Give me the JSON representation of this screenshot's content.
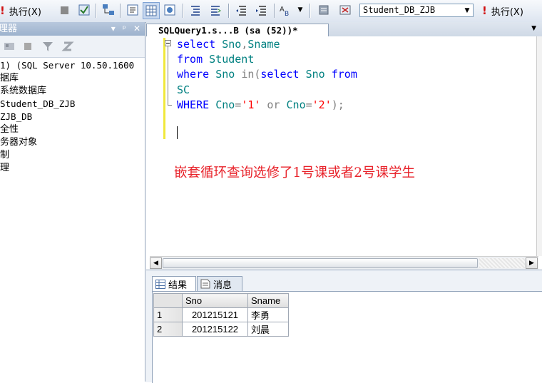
{
  "toolbar": {
    "execute_label": "执行(X)",
    "database": "Student_DB_ZJB",
    "execute_label_2": "执行(X)"
  },
  "explorer": {
    "title": "理器",
    "pin_symbol": "▾ ᵖ ✕",
    "items": [
      "1) (SQL Server 10.50.1600",
      "据库",
      "系统数据库",
      "Student_DB_ZJB",
      "ZJB_DB",
      "全性",
      "务器对象",
      "制",
      "理"
    ]
  },
  "editor": {
    "tab_label": "SQLQuery1.s...B (sa (52))*",
    "lines": [
      [
        {
          "t": "select ",
          "c": "kw"
        },
        {
          "t": "Sno",
          "c": "id"
        },
        {
          "t": ",",
          "c": "op"
        },
        {
          "t": "Sname",
          "c": "id"
        }
      ],
      [
        {
          "t": "from ",
          "c": "kw"
        },
        {
          "t": "Student",
          "c": "id"
        }
      ],
      [
        {
          "t": "where ",
          "c": "kw"
        },
        {
          "t": "Sno ",
          "c": "id"
        },
        {
          "t": "in",
          "c": "op"
        },
        {
          "t": "(",
          "c": "op"
        },
        {
          "t": "select ",
          "c": "kw"
        },
        {
          "t": "Sno ",
          "c": "id"
        },
        {
          "t": "from",
          "c": "kw"
        }
      ],
      [
        {
          "t": "SC",
          "c": "id"
        }
      ],
      [
        {
          "t": "WHERE ",
          "c": "kw"
        },
        {
          "t": "Cno",
          "c": "id"
        },
        {
          "t": "=",
          "c": "op"
        },
        {
          "t": "'1'",
          "c": "str"
        },
        {
          "t": " or ",
          "c": "op"
        },
        {
          "t": "Cno",
          "c": "id"
        },
        {
          "t": "=",
          "c": "op"
        },
        {
          "t": "'2'",
          "c": "str"
        },
        {
          "t": ");",
          "c": "op"
        }
      ]
    ],
    "caption": "嵌套循环查询选修了1号课或者2号课学生"
  },
  "results": {
    "tab_results": "结果",
    "tab_messages": "消息",
    "columns": [
      "Sno",
      "Sname"
    ],
    "rows": [
      {
        "n": "1",
        "Sno": "201215121",
        "Sname": "李勇"
      },
      {
        "n": "2",
        "Sno": "201215122",
        "Sname": "刘晨"
      }
    ]
  },
  "colors": {
    "keyword": "#0000ff",
    "identifier": "#008080",
    "string": "#ff0000",
    "operator": "#808080",
    "caption": "#e8232b"
  }
}
